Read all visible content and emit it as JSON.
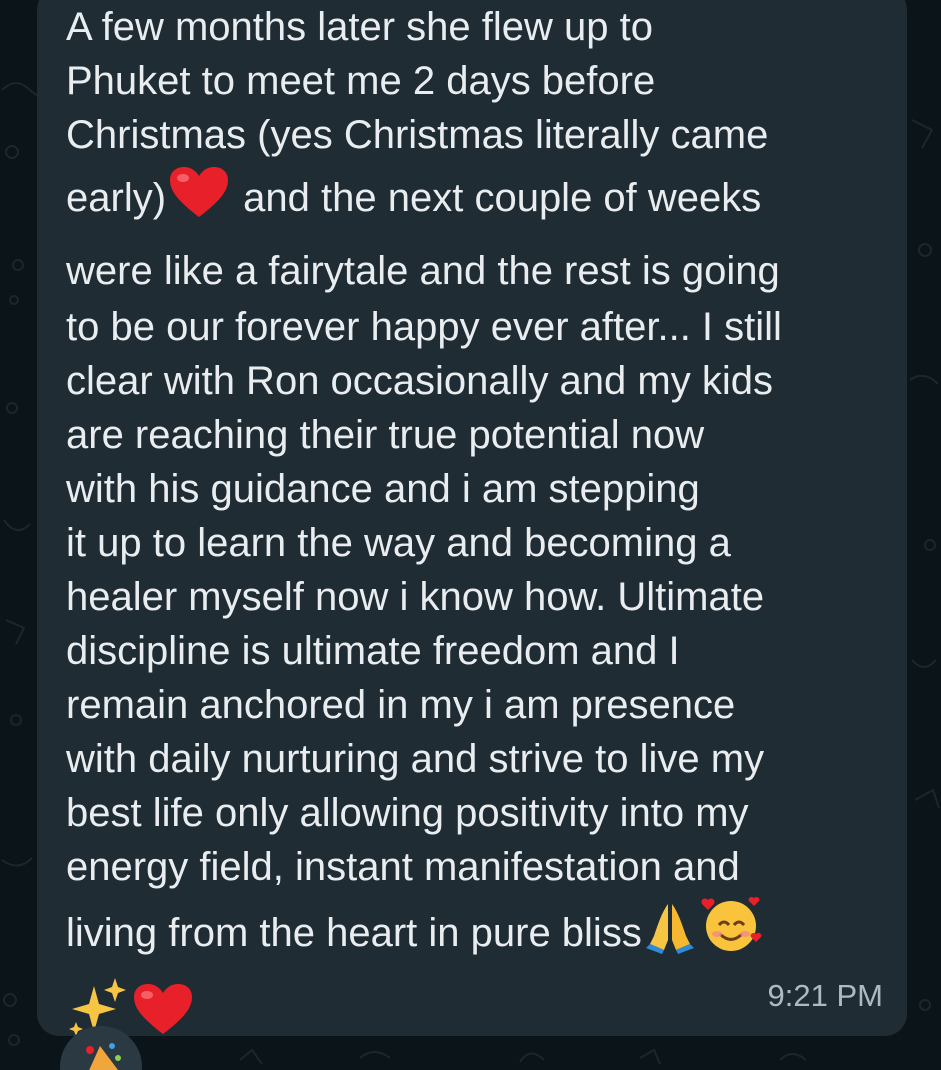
{
  "message": {
    "lines": [
      "A few months later she flew up to",
      "Phuket to meet me 2 days before",
      "Christmas (yes Christmas literally came",
      "early)",
      "and the next couple of weeks",
      "were like a fairytale and the rest is going",
      "to be our forever happy ever after... I still",
      "clear with Ron occasionally and my kids",
      "are reaching their true potential now",
      "with his guidance and i am stepping",
      "it up to learn the way and becoming a",
      "healer myself now i know how. Ultimate",
      "discipline is ultimate freedom and I",
      "remain anchored in my i am presence",
      "with daily nurturing and strive to live my",
      "best life only allowing positivity into my",
      "energy field, instant manifestation and",
      "living from the heart in pure bliss"
    ],
    "timestamp": "9:21 PM",
    "emojis": [
      "red-heart",
      "folded-hands",
      "smiling-face-with-hearts",
      "sparkles",
      "red-heart"
    ]
  },
  "colors": {
    "background": "#0b1418",
    "bubble": "#1f2c33",
    "text": "#e9edef",
    "timestamp": "#aebac1",
    "heart": "#e8202a"
  }
}
